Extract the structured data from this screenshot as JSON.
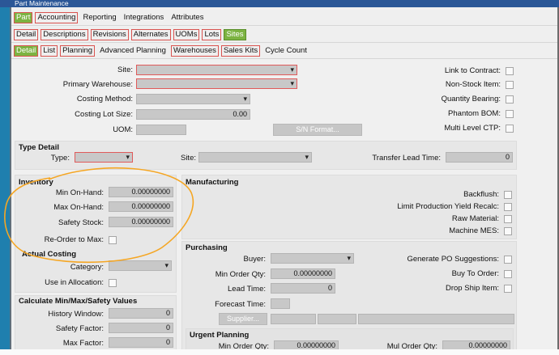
{
  "window": {
    "title": "Part Maintenance"
  },
  "top_tabs": [
    "Part",
    "Accounting",
    "Reporting",
    "Integrations",
    "Attributes"
  ],
  "sub_tabs": [
    "Detail",
    "Descriptions",
    "Revisions",
    "Alternates",
    "UOMs",
    "Lots",
    "Sites"
  ],
  "detail_tabs": [
    "Detail",
    "List",
    "Planning",
    "Advanced Planning",
    "Warehouses",
    "Sales Kits",
    "Cycle Count"
  ],
  "general": {
    "site_label": "Site:",
    "primary_warehouse_label": "Primary Warehouse:",
    "costing_method_label": "Costing Method:",
    "costing_lot_size_label": "Costing Lot Size:",
    "costing_lot_size_value": "0.00",
    "uom_label": "UOM:",
    "sn_format_button": "S/N Format...",
    "link_to_contract": "Link to Contract:",
    "non_stock_item": "Non-Stock Item:",
    "quantity_bearing": "Quantity Bearing:",
    "phantom_bom": "Phantom BOM:",
    "multi_level_ctp": "Multi Level CTP:"
  },
  "type_detail": {
    "header": "Type Detail",
    "type_label": "Type:",
    "site_label": "Site:",
    "transfer_lead_time_label": "Transfer Lead Time:",
    "transfer_lead_time_value": "0"
  },
  "inventory": {
    "header": "Inventory",
    "min_on_hand_label": "Min On-Hand:",
    "min_on_hand_value": "0.00000000",
    "max_on_hand_label": "Max On-Hand:",
    "max_on_hand_value": "0.00000000",
    "safety_stock_label": "Safety Stock:",
    "safety_stock_value": "0.00000000",
    "reorder_to_max_label": "Re-Order to Max:"
  },
  "actual_costing": {
    "header": "Actual Costing",
    "category_label": "Category:",
    "use_in_allocation_label": "Use in Allocation:"
  },
  "calculate": {
    "header": "Calculate Min/Max/Safety Values",
    "history_window_label": "History Window:",
    "history_window_value": "0",
    "safety_factor_label": "Safety Factor:",
    "safety_factor_value": "0",
    "max_factor_label": "Max Factor:",
    "max_factor_value": "0"
  },
  "manufacturing": {
    "header": "Manufacturing",
    "backflush": "Backflush:",
    "limit_production_yield": "Limit Production Yield Recalc:",
    "raw_material": "Raw Material:",
    "machine_mes": "Machine MES:"
  },
  "purchasing": {
    "header": "Purchasing",
    "buyer_label": "Buyer:",
    "min_order_qty_label": "Min Order Qty:",
    "min_order_qty_value": "0.00000000",
    "lead_time_label": "Lead Time:",
    "lead_time_value": "0",
    "forecast_time_label": "Forecast Time:",
    "supplier_button": "Supplier...",
    "generate_po": "Generate PO Suggestions:",
    "buy_to_order": "Buy To Order:",
    "drop_ship_item": "Drop Ship Item:"
  },
  "urgent_planning": {
    "header": "Urgent Planning",
    "min_order_qty_label": "Min Order Qty:",
    "min_order_qty_value": "0.00000000",
    "mul_order_qty_label": "Mul Order Qty:",
    "mul_order_qty_value": "0.00000000"
  },
  "colors": {
    "active_tab": "#7cb342",
    "required_border": "#d9534f",
    "annotation": "#f5a623",
    "titlebar": "#2b5797"
  }
}
